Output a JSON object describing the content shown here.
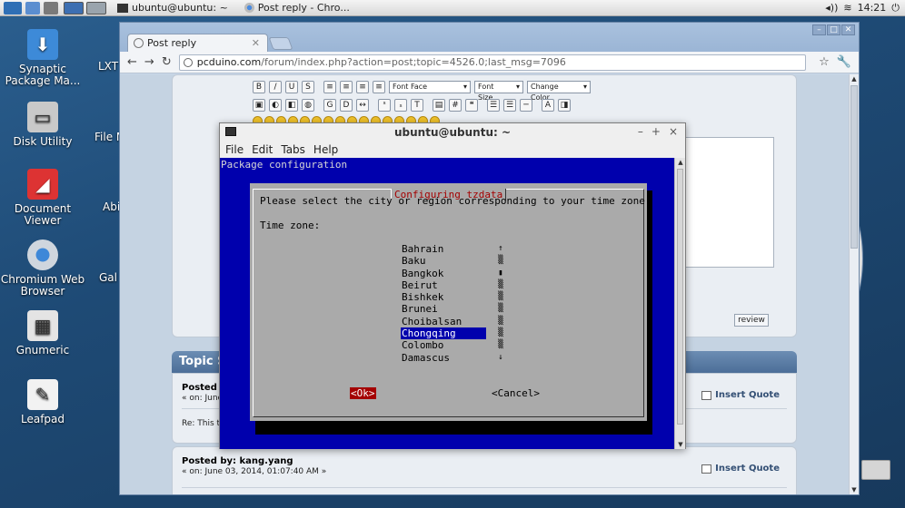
{
  "panel": {
    "tasks": [
      {
        "label": "ubuntu@ubuntu: ~"
      },
      {
        "label": "Post reply - Chro..."
      }
    ],
    "clock": "14:21"
  },
  "desktop": {
    "icons": [
      {
        "label": "Synaptic Package Ma..."
      },
      {
        "label": "Disk Utility"
      },
      {
        "label": "Document Viewer"
      },
      {
        "label": "Chromium Web Browser"
      },
      {
        "label": "Gnumeric"
      },
      {
        "label": "Leafpad"
      }
    ],
    "partial_icons": [
      "LXT",
      "File M",
      "Abi",
      "Gal"
    ]
  },
  "browser": {
    "tab_title": "Post reply",
    "url_host": "pcduino.com",
    "url_path": "/forum/index.php?action=post;topic=4526.0;last_msg=7096",
    "font_face": "Font Face",
    "font_size": "Font Size",
    "change_color": "Change Color",
    "preview_label": "review",
    "topic_summary": "Topic S",
    "posts": [
      {
        "posted_label": "Posted",
        "on_label": "« on: June",
        "body": "Re: This t",
        "insert_quote": "Insert Quote"
      },
      {
        "posted_label": "Posted by: kang.yang",
        "on_label": "« on: June 03, 2014, 01:07:40 AM »",
        "insert_quote": "Insert Quote"
      }
    ]
  },
  "terminal": {
    "title": "ubuntu@ubuntu: ~",
    "menu": [
      "File",
      "Edit",
      "Tabs",
      "Help"
    ],
    "header": "Package configuration",
    "dialog": {
      "title": "Configuring tzdata",
      "prompt": "Please select the city or region corresponding to your time zone.",
      "label": "Time zone:",
      "zones": [
        "Bahrain",
        "Baku",
        "Bangkok",
        "Beirut",
        "Bishkek",
        "Brunei",
        "Choibalsan",
        "Chongqing",
        "Colombo",
        "Damascus"
      ],
      "selected": "Chongqing",
      "ok": "<Ok>",
      "cancel": "<Cancel>"
    }
  },
  "colors": {
    "terminal_bg": "#0000ad",
    "dialog_bg": "#aaaaaa",
    "dialog_title": "#a40000",
    "ok_bg": "#a40000"
  }
}
